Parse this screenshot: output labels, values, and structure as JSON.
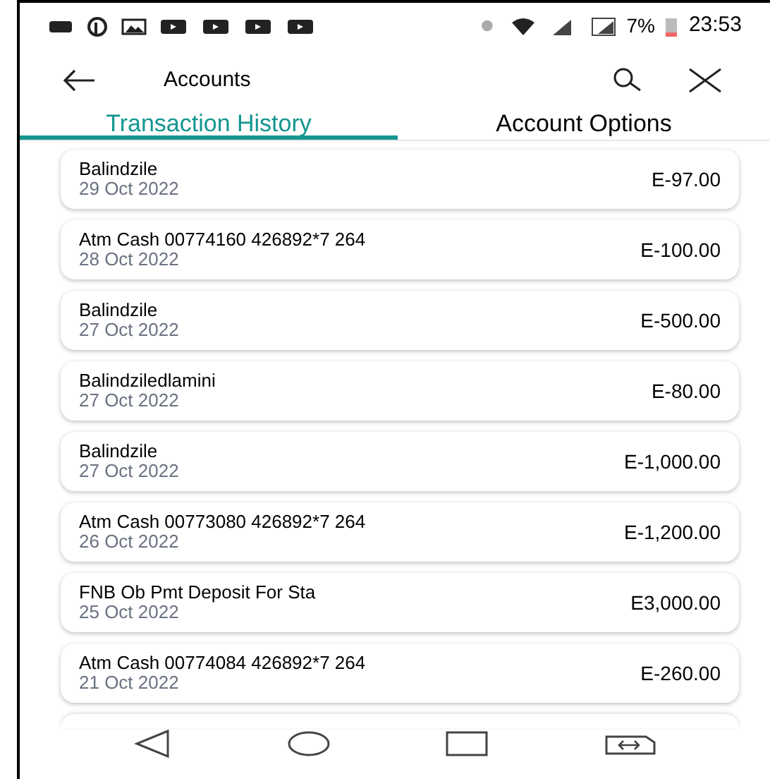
{
  "status_bar": {
    "battery": "7%",
    "time": "23:53"
  },
  "header": {
    "title": "Accounts"
  },
  "tabs": [
    {
      "label": "Transaction History",
      "selected": true
    },
    {
      "label": "Account Options",
      "selected": false
    }
  ],
  "transactions": [
    {
      "description": "Balindzile",
      "date": "29 Oct 2022",
      "amount": "E-97.00"
    },
    {
      "description": "Atm Cash 00774160 426892*7 264",
      "date": "28 Oct 2022",
      "amount": "E-100.00"
    },
    {
      "description": "Balindzile",
      "date": "27 Oct 2022",
      "amount": "E-500.00"
    },
    {
      "description": "Balindziledlamini",
      "date": "27 Oct 2022",
      "amount": "E-80.00"
    },
    {
      "description": "Balindzile",
      "date": "27 Oct 2022",
      "amount": "E-1,000.00"
    },
    {
      "description": "Atm Cash 00773080 426892*7 264",
      "date": "26 Oct 2022",
      "amount": "E-1,200.00"
    },
    {
      "description": "FNB Ob Pmt Deposit For Sta",
      "date": "25 Oct 2022",
      "amount": "E3,000.00"
    },
    {
      "description": "Atm Cash 00774084 426892*7 264",
      "date": "21 Oct 2022",
      "amount": "E-260.00"
    }
  ]
}
